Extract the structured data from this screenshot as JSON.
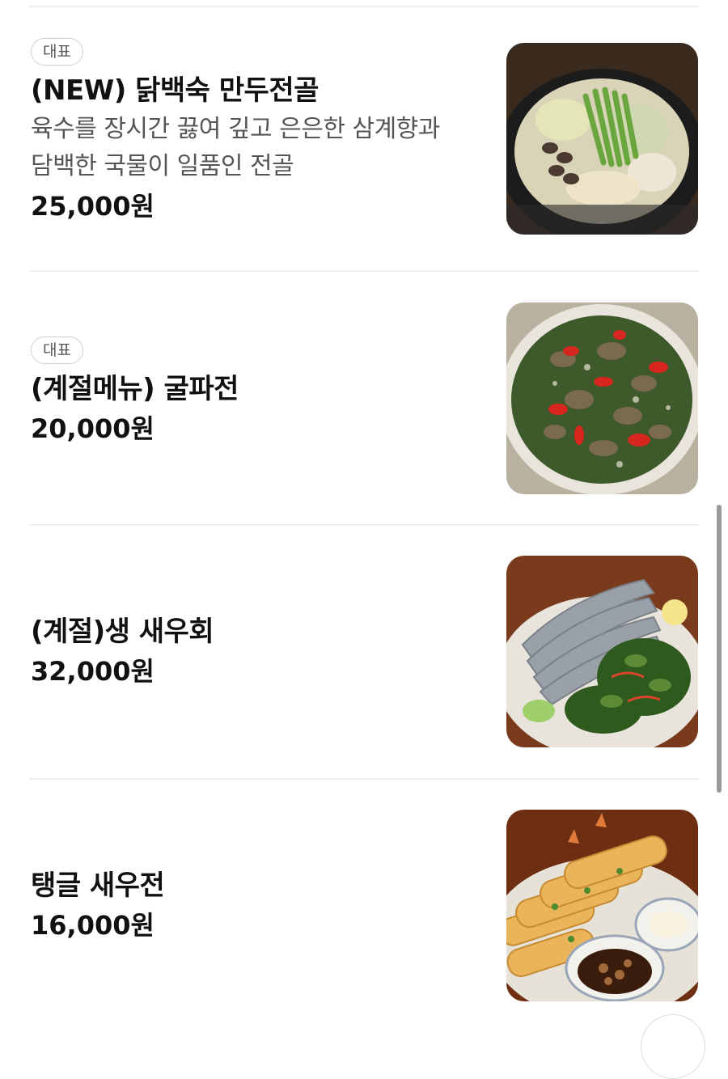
{
  "menu": {
    "items": [
      {
        "badge": "대표",
        "name": "(NEW) 닭백숙 만두전골",
        "description_line1": "육수를 장시간 끓여 깊고 은은한 삼계향과",
        "description_line2": "담백한 국물이 일품인 전골",
        "price": "25,000원",
        "image": "hotpot-dumpling-photo"
      },
      {
        "badge": "대표",
        "name": "(계절메뉴) 굴파전",
        "price": "20,000원",
        "image": "oyster-pancake-photo"
      },
      {
        "name": "(계절)생 새우회",
        "price": "32,000원",
        "image": "raw-shrimp-photo"
      },
      {
        "name": "탱글 새우전",
        "price": "16,000원",
        "image": "shrimp-jeon-photo"
      }
    ]
  },
  "colors": {
    "text_primary": "#111111",
    "text_secondary": "#555555",
    "divider": "#efefef",
    "badge_border": "#cfcfcf"
  }
}
